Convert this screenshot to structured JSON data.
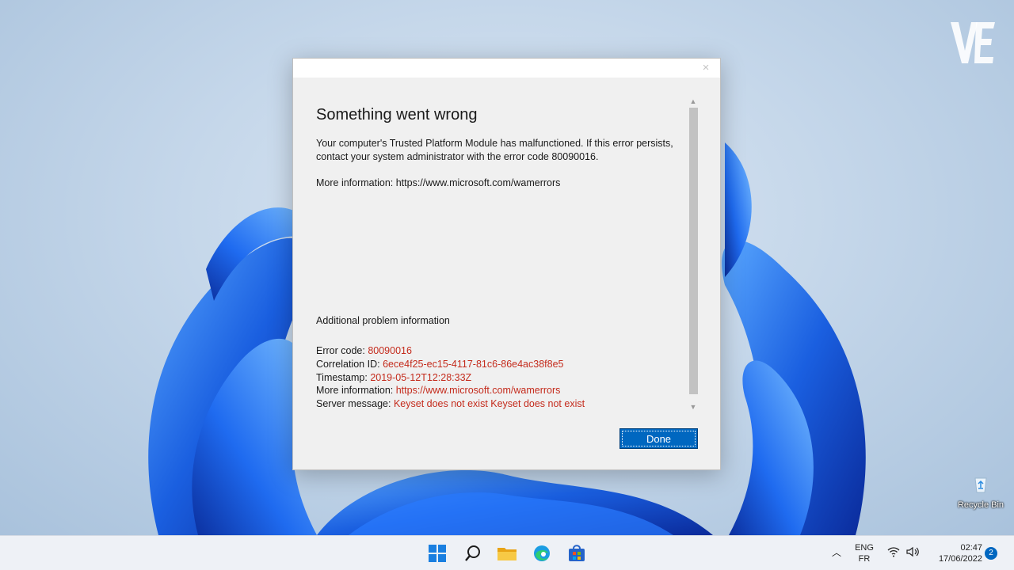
{
  "dialog": {
    "heading": "Something went wrong",
    "message_line1": "Your computer's Trusted Platform Module has malfunctioned. If this error persists,",
    "message_line2": "contact your system administrator with the error code 80090016.",
    "more_info": "More information: https://www.microsoft.com/wamerrors",
    "additional_title": "Additional problem information",
    "details": [
      {
        "label": "Error code: ",
        "value": "80090016"
      },
      {
        "label": "Correlation ID: ",
        "value": "6ece4f25-ec15-4117-81c6-86e4ac38f8e5"
      },
      {
        "label": "Timestamp: ",
        "value": "2019-05-12T12:28:33Z"
      },
      {
        "label": "More information: ",
        "value": "https://www.microsoft.com/wamerrors"
      },
      {
        "label": "Server message: ",
        "value": "Keyset does not exist Keyset does not exist"
      }
    ],
    "done_label": "Done",
    "close_glyph": "×"
  },
  "desktop": {
    "recycle_bin_label": "Recycle Bin",
    "watermark": "VE"
  },
  "taskbar": {
    "icons": [
      "start-icon",
      "search-icon",
      "file-explorer-icon",
      "edge-icon",
      "store-icon"
    ],
    "lang_line1": "ENG",
    "lang_line2": "FR",
    "time": "02:47",
    "date": "17/06/2022",
    "notification_count": "2"
  },
  "colors": {
    "accent": "#0067c0",
    "error_value": "#c42b1c",
    "dialog_bg": "#f0f0f0"
  }
}
